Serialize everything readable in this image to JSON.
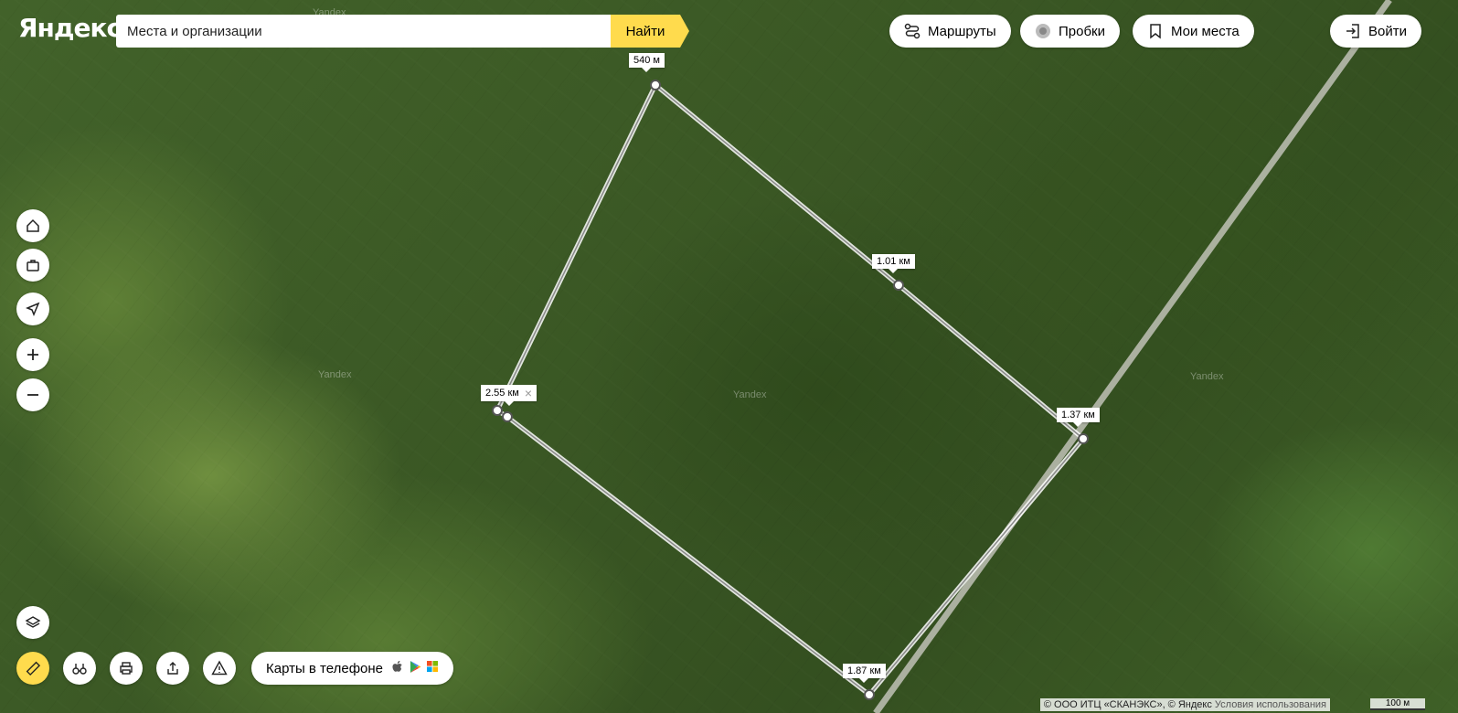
{
  "header": {
    "logo": "Яндекс",
    "search_placeholder": "Места и организации",
    "find_label": "Найти",
    "routes_label": "Маршруты",
    "traffic_label": "Пробки",
    "my_places_label": "Мои места",
    "login_label": "Войти"
  },
  "map": {
    "watermark": "Yandex",
    "ruler_labels": {
      "p1": "540 м",
      "p2": "1.01 км",
      "p3": "1.37 км",
      "p4": "1.87 км",
      "p5": "2.55 км"
    }
  },
  "bottom": {
    "apps_label": "Карты в телефоне"
  },
  "footer": {
    "copyright": "© ООО ИТЦ «СКАНЭКС», © Яндекс",
    "terms_link": "Условия использования",
    "scale": "100 м"
  }
}
